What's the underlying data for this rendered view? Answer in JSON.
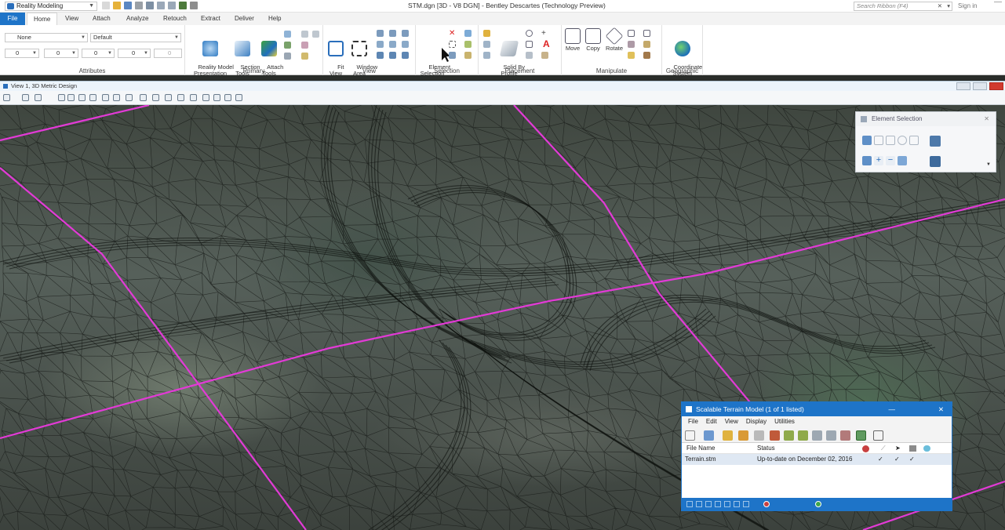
{
  "titlebar": {
    "workflow": "Reality Modeling",
    "document_title": "STM.dgn [3D - V8 DGN] - Bentley Descartes (Technology Preview)",
    "search_placeholder": "Search Ribbon (F4)",
    "sign_in": "Sign in"
  },
  "tabs": [
    "File",
    "Home",
    "View",
    "Attach",
    "Analyze",
    "Retouch",
    "Extract",
    "Deliver",
    "Help"
  ],
  "ribbon": {
    "attributes": {
      "label": "Attributes",
      "level": "None",
      "style": "Default",
      "color": "0",
      "linestyle": "0",
      "weight": "0",
      "transparency": "0",
      "priority": "0"
    },
    "primary": {
      "label": "Primary",
      "buttons": [
        "Reality Model\nPresentation",
        "Section\nTools",
        "Attach\nTools"
      ]
    },
    "view": {
      "label": "View",
      "buttons": [
        "Fit\nView",
        "Window\nArea"
      ]
    },
    "selection": {
      "label": "Selection",
      "buttons": [
        "Element\nSelection"
      ]
    },
    "placement": {
      "label": "Placement",
      "buttons": [
        "Solid By\nProfile"
      ]
    },
    "manipulate": {
      "label": "Manipulate",
      "buttons": [
        "Move",
        "Copy",
        "Rotate"
      ]
    },
    "geographic": {
      "label": "Geographic",
      "buttons": [
        "Coordinate\nSystem"
      ]
    }
  },
  "view": {
    "title": "View 1, 3D Metric Design"
  },
  "element_selection": {
    "title": "Element Selection"
  },
  "stm_dialog": {
    "title": "Scalable Terrain Model (1 of 1 listed)",
    "menu": [
      "File",
      "Edit",
      "View",
      "Display",
      "Utilities"
    ],
    "columns": [
      "File Name",
      "Status"
    ],
    "rows": [
      {
        "file": "Terrain.stm",
        "status": "Up-to-date on December 02, 2016",
        "check1": "✓",
        "check2": "✓",
        "check3": "✓"
      }
    ]
  },
  "colors": {
    "accent": "#1e74c8",
    "alignment_lines": "#e23ad6"
  }
}
